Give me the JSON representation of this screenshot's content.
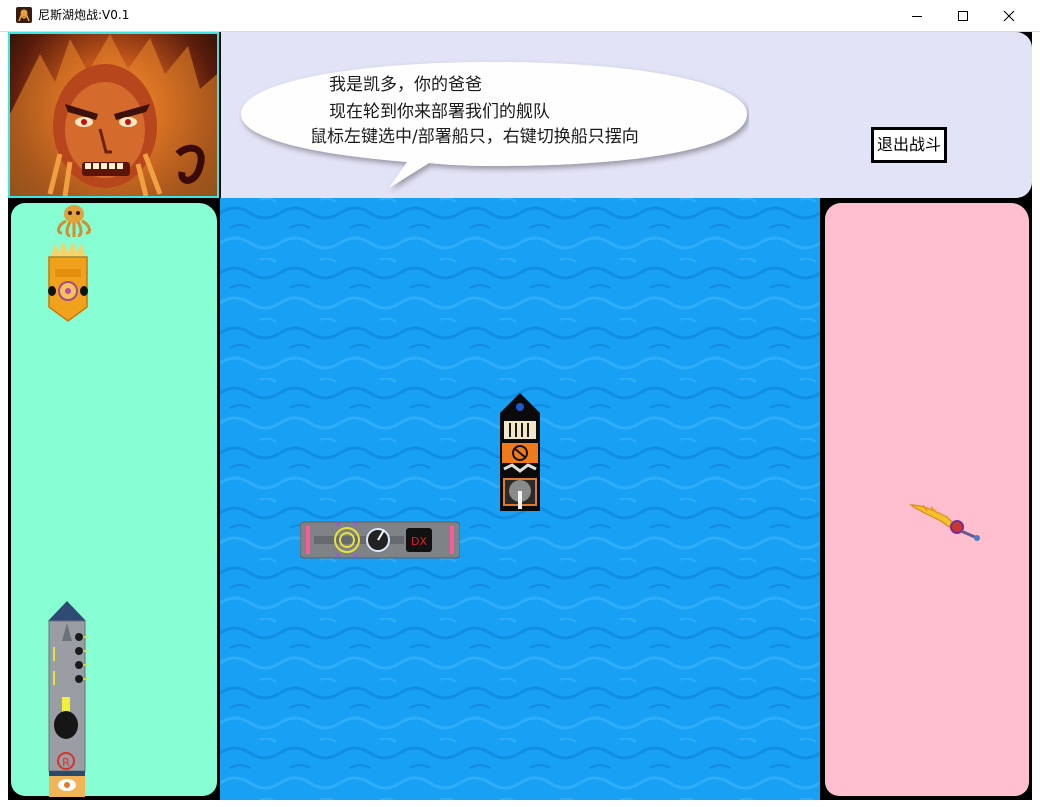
{
  "window": {
    "title": "尼斯湖炮战:V0.1",
    "controls": [
      "minimize-icon",
      "maximize-icon",
      "close-icon"
    ]
  },
  "dialog": {
    "lines": [
      "我是凯多，你的爸爸",
      "现在轮到你来部署我们的舰队",
      "鼠标左键选中/部署船只，右键切换船只摆向"
    ],
    "exit_button": "退出战斗"
  },
  "colors": {
    "portrait_border": "#39e6e6",
    "dialog_panel": "#e3e3f7",
    "left_dock": "#86fdd3",
    "sea": "#18a0f4",
    "right_dock": "#ffbfce"
  },
  "sprites": {
    "left_dock": [
      "octopus-icon",
      "golden-ship-icon",
      "tall-warship-icon"
    ],
    "sea": [
      "black-ship-icon",
      "grey-ship-icon"
    ],
    "right_dock": [
      "golden-sword-icon"
    ]
  }
}
